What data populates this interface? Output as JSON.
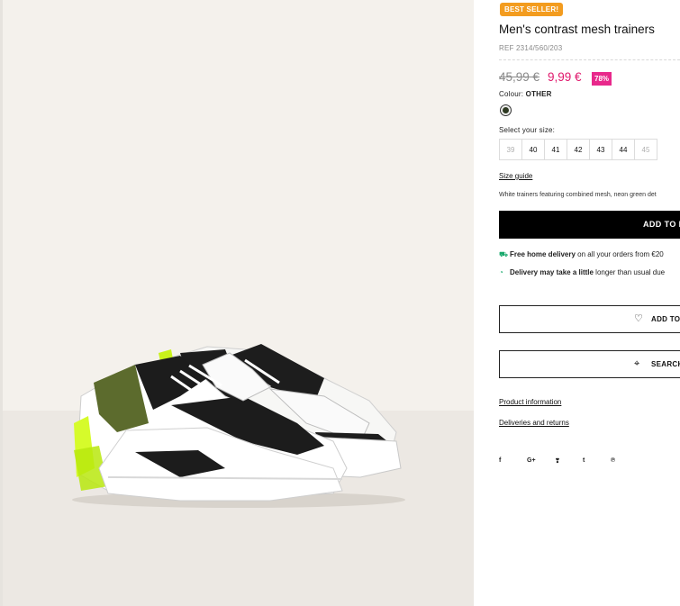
{
  "product": {
    "badge": "BEST SELLER!",
    "title": "Men's contrast mesh trainers",
    "ref": "REF 2314/560/203",
    "old_price": "45,99 €",
    "new_price": "9,99 €",
    "discount": "78%",
    "colour_label": "Colour:",
    "colour_value": "OTHER",
    "size_label": "Select your size:",
    "sizes": [
      {
        "label": "39",
        "available": false
      },
      {
        "label": "40",
        "available": true
      },
      {
        "label": "41",
        "available": true
      },
      {
        "label": "42",
        "available": true
      },
      {
        "label": "43",
        "available": true
      },
      {
        "label": "44",
        "available": true
      },
      {
        "label": "45",
        "available": false
      }
    ],
    "size_guide": "Size guide",
    "description": "White trainers featuring combined mesh, neon green det",
    "add_to_bag": "ADD TO B"
  },
  "delivery": {
    "free_bold": "Free home delivery",
    "free_rest": " on all your orders from €20",
    "delay_bold": "Delivery may take a little",
    "delay_rest": " longer than usual due"
  },
  "actions": {
    "wishlist": "ADD TO",
    "search_store": "SEARCH"
  },
  "links": {
    "product_info": "Product information",
    "deliveries": "Deliveries and returns"
  },
  "social": [
    "f",
    "G+",
    "t-bird",
    "t",
    "p"
  ],
  "social_icons": [
    "facebook-icon",
    "google-plus-icon",
    "twitter-icon",
    "tumblr-icon",
    "pinterest-icon"
  ],
  "colors": {
    "badge": "#f39c1f",
    "sale_price": "#e0186c",
    "discount": "#e8288b",
    "button": "#000000",
    "delivery_icon": "#17a86b"
  }
}
